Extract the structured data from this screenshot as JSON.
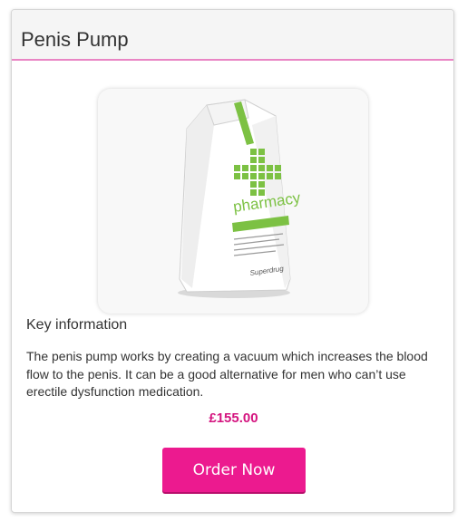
{
  "card": {
    "title": "Penis Pump",
    "accent_color": "#e985c4"
  },
  "product_image": {
    "bag_brand": "pharmacy",
    "bag_maker": "Superdrug",
    "accent_color": "#7cc143"
  },
  "info": {
    "heading": "Key information",
    "description": "The penis pump works by creating a vacuum which increases the blood flow to the penis. It can be a good alternative for men who can’t use erectile dysfunction medication."
  },
  "price": {
    "text": "£155.00",
    "color": "#d4147f"
  },
  "order_button": {
    "label": "Order Now",
    "color": "#ec1a8f"
  }
}
